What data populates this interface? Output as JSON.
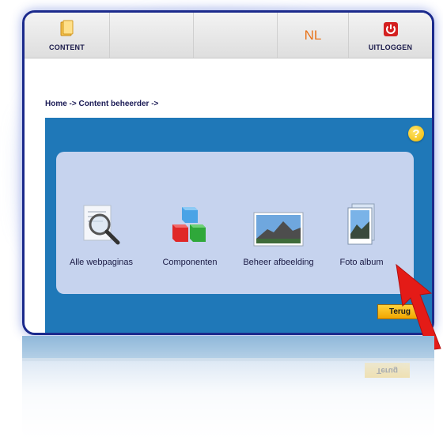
{
  "toolbar": {
    "content_label": "CONTENT",
    "language": "NL",
    "logout_label": "UITLOGGEN"
  },
  "breadcrumb": "Home -> Content beheerder ->",
  "panel": {
    "help_symbol": "?",
    "items": [
      {
        "label": "Alle webpaginas",
        "icon": "magnifier-document-icon"
      },
      {
        "label": "Componenten",
        "icon": "cubes-icon"
      },
      {
        "label": "Beheer afbeelding",
        "icon": "landscape-image-icon"
      },
      {
        "label": "Foto album",
        "icon": "photo-album-icon"
      }
    ],
    "back_label": "Terug",
    "back_reflection_label": "Terug"
  },
  "colors": {
    "frame": "#1b2a8c",
    "panel_blue": "#1f78b8",
    "inner_panel": "#c6d3ee",
    "language_orange": "#e8731a",
    "button_yellow": "#f0b800",
    "arrow_red": "#e41b17"
  }
}
